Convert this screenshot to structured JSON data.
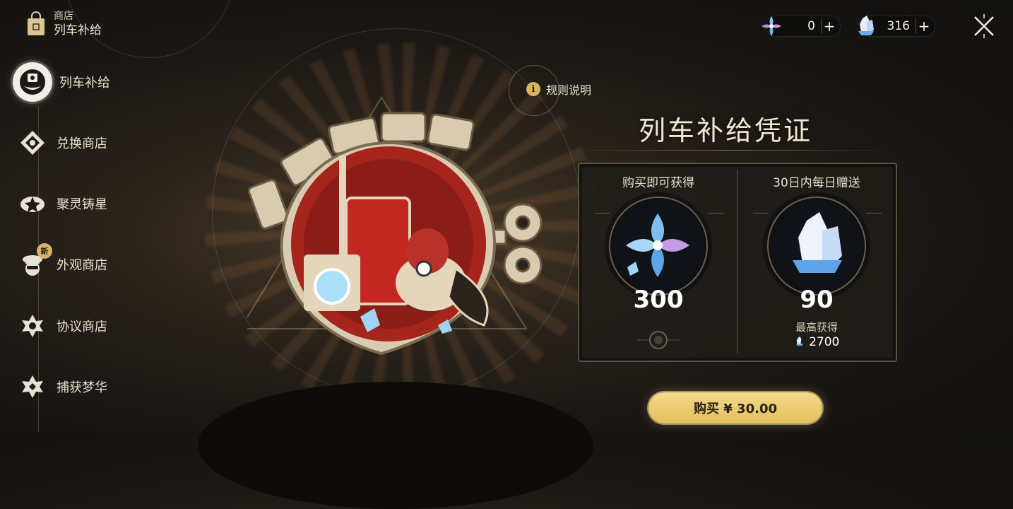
{
  "store": {
    "title": "商店",
    "subtitle": "列车补给"
  },
  "sidebar": {
    "items": [
      {
        "label": "列车补给",
        "icon": "train-supply-icon",
        "active": true
      },
      {
        "label": "兑换商店",
        "icon": "exchange-shop-icon"
      },
      {
        "label": "聚灵铸星",
        "icon": "star-forge-icon"
      },
      {
        "label": "外观商店",
        "icon": "appearance-shop-icon",
        "badge": "新"
      },
      {
        "label": "协议商店",
        "icon": "protocol-shop-icon"
      },
      {
        "label": "捕获梦华",
        "icon": "dream-capture-icon"
      }
    ]
  },
  "currency": {
    "premium": {
      "icon": "stellar-jade-flower-icon",
      "value": "0"
    },
    "crystal": {
      "icon": "crystal-icon",
      "value": "316"
    }
  },
  "rules_label": "规则说明",
  "pass_title": "列车补给凭证",
  "rewards": {
    "instant": {
      "heading": "购买即可获得",
      "amount": "300"
    },
    "daily": {
      "heading": "30日内每日赠送",
      "amount": "90",
      "max_label": "最高获得",
      "max_value": "2700"
    }
  },
  "buy_button": "购买 ¥ 30.00",
  "colors": {
    "accent": "#e5c05c",
    "panel_border": "#5b5243",
    "badge_red": "#a5241c"
  }
}
